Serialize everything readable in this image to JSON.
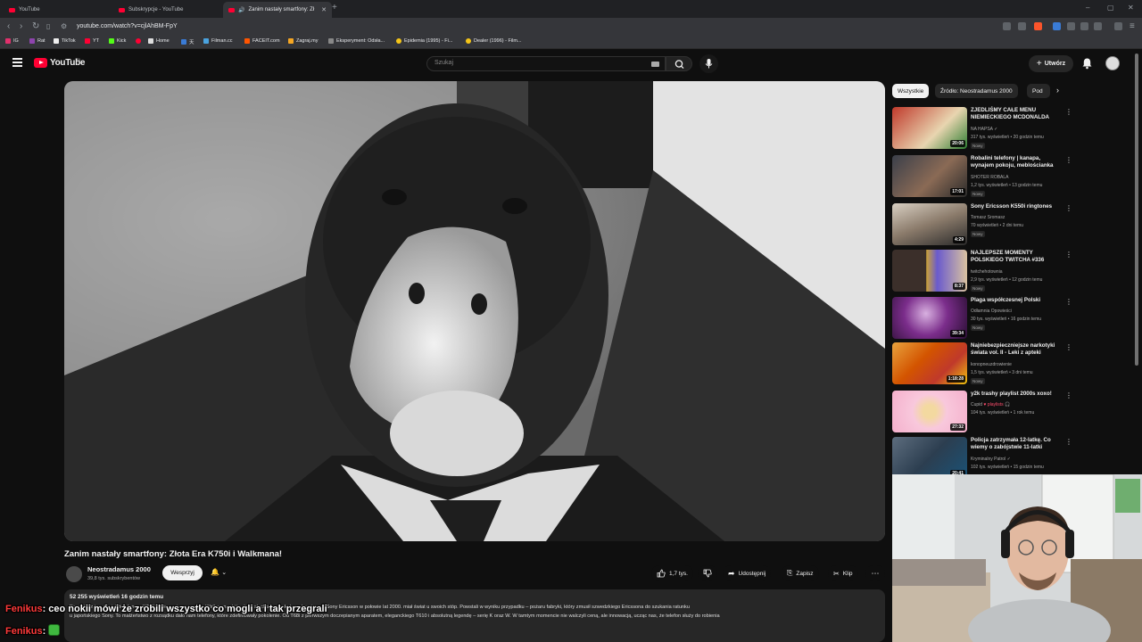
{
  "browser": {
    "tabs": [
      {
        "label": "YouTube",
        "active": false
      },
      {
        "label": "Subskrypcje - YouTube",
        "active": false
      },
      {
        "label": "Zanim nastały smartfony: Zł",
        "active": true
      }
    ],
    "url": "youtube.com/watch?v=cjlAhBM-FpY",
    "bookmarks": [
      {
        "label": "IG",
        "color": "#e1306c"
      },
      {
        "label": "Rat",
        "color": "#8e44ad"
      },
      {
        "label": "TikTok",
        "color": "#111111"
      },
      {
        "label": "YT",
        "color": "#ff0033"
      },
      {
        "label": "Kick",
        "color": "#53fc18"
      },
      {
        "label": "",
        "color": "#ff0033"
      },
      {
        "label": "Home",
        "color": "#dddddd"
      },
      {
        "label": "天",
        "color": "#3a7bd5"
      },
      {
        "label": "Filman.cc",
        "color": "#4aa3df"
      },
      {
        "label": "FACEIT.com",
        "color": "#ff5500"
      },
      {
        "label": "Zagraj.my",
        "color": "#f5a623"
      },
      {
        "label": "Eksperyment: Odsła...",
        "color": "#888888"
      },
      {
        "label": "Epidemia (1995) - Fi...",
        "color": "#f5c518"
      },
      {
        "label": "Dealer (1996) - Film...",
        "color": "#f5c518"
      }
    ]
  },
  "youtube": {
    "logo_text": "YouTube",
    "region": "PL",
    "search_placeholder": "Szukaj",
    "create_label": "Utwórz"
  },
  "video": {
    "title": "Zanim nastały smartfony: Złota Era K750i i Walkmana!",
    "channel": "Neostradamus 2000",
    "subscribers": "39,8 tys. subskrybentów",
    "support_label": "Wesprzyj",
    "likes": "1,7 tys.",
    "share_label": "Udostępnij",
    "save_label": "Zapisz",
    "clip_label": "Klip",
    "views_meta": "52 255 wyświetleń  16 godzin temu",
    "description_line1": "Pamiętasz ten dźwięk telefonu z K750i, którym się szczycił w Walkmana, który było słychać na szkolnym korytarzu? Sony Ericsson w połowie lat 2000. miał świat u swoich stóp. Powstali w wyniku przypadku – pożaru fabryki, który zmusił szwedzkiego Ericssona do szukania ratunku",
    "description_line2": "u japońskiego Sony. To małżeństwo z rozsądku dało nam telefony, które zdefiniowały pokolenie. Od T68i z pierwszym doczepianym aparatem, eleganckiego T610 i absolutną legendę – serię K oraz W. W tamtym momencie nie walczyli ceną, ale innowacją, ucząc nas, że telefon służy do robienia"
  },
  "sidebar": {
    "chips": [
      "Wszystkie",
      "Źródło: Neostradamus 2000",
      "Pod"
    ],
    "items": [
      {
        "title": "ZJEDLIŚMY CAŁE MENU NIEMIECKIEGO MCDONALDA",
        "channel": "NA HAPSA",
        "verified": "✓",
        "meta": "317 tys. wyświetleń • 20 godzin temu",
        "badge": "Nowy",
        "duration": "20:06",
        "thumb_color": "#c0392b"
      },
      {
        "title": "Robalini telefony | kanapa, wynajem pokoju, meblościanka",
        "channel": "SHOTER ROBALA",
        "verified": "",
        "meta": "1,2 tys. wyświetleń • 13 godzin temu",
        "badge": "Nowy",
        "duration": "17:01",
        "thumb_color": "#5a4a3a"
      },
      {
        "title": "Sony Ericsson K550i ringtones",
        "channel": "Tomasz Sromasz",
        "verified": "",
        "meta": "70 wyświetleń • 2 dni temu",
        "badge": "Nowy",
        "duration": "4:29",
        "thumb_color": "#8a7a6a"
      },
      {
        "title": "NAJLEPSZE MOMENTY POLSKIEGO TWITCHA #336",
        "channel": "twitchehotownia",
        "verified": "",
        "meta": "2,9 tys. wyświetleń • 12 godzin temu",
        "badge": "Nowy",
        "duration": "8:37",
        "thumb_color": "#6a5acd"
      },
      {
        "title": "Plaga współczesnej Polski",
        "channel": "Odłamnia Opowieści",
        "verified": "",
        "meta": "30 tys. wyświetleń • 16 godzin temu",
        "badge": "Nowy",
        "duration": "39:34",
        "thumb_color": "#7b2d8b"
      },
      {
        "title": "Najniebezpieczniejsze narkotyki świata vol. II - Leki z apteki",
        "channel": "konopneuzdrowienie",
        "verified": "",
        "meta": "1,5 tys. wyświetleń • 3 dni temu",
        "badge": "Nowy",
        "duration": "1:18:28",
        "thumb_color": "#d35400"
      },
      {
        "title": "y2k trashy playlist 2000s xoxo!",
        "channel": "Cupid",
        "verified": "♥ playlists 🎧",
        "meta": "104 tys. wyświetleń • 1 rok temu",
        "badge": "",
        "duration": "27:32",
        "thumb_color": "#f8c8dc"
      },
      {
        "title": "Policja zatrzymała 12-latkę. Co wiemy o zabójstwie 11-latki",
        "channel": "Kryminalny Patrol",
        "verified": "✓",
        "meta": "102 tys. wyświetleń • 15 godzin temu",
        "badge": "",
        "duration": "20:41",
        "thumb_color": "#2c3e50"
      }
    ]
  },
  "chat": [
    {
      "user": "Fenikus",
      "message": ": ceo nokii mówi że zrobili wszystko co mogli a i tak przegrali"
    },
    {
      "user": "Fenikus",
      "message": ":"
    }
  ],
  "colors": {
    "background": "#0f0f0f",
    "accent_red": "#ff0033",
    "chip_bg": "#272727",
    "chat_user": "#ff3a3a"
  }
}
